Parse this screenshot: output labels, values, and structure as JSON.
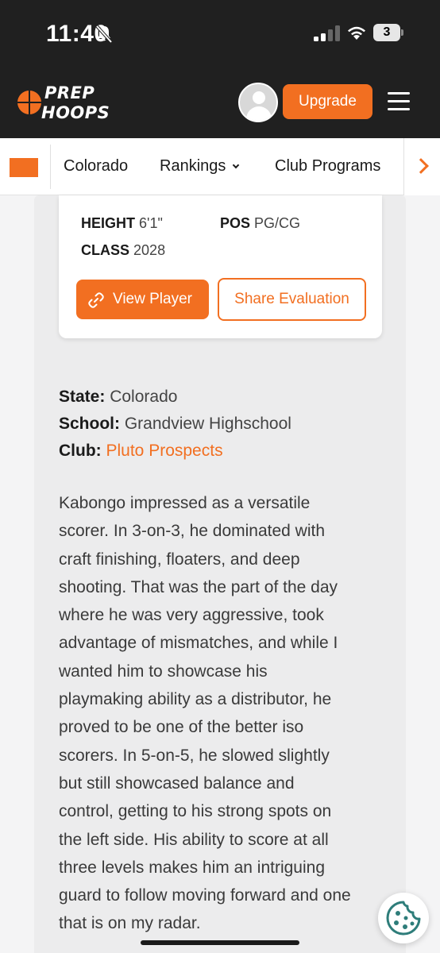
{
  "status_bar": {
    "time": "11:40",
    "battery": "3"
  },
  "header": {
    "logo_line1": "PREP",
    "logo_line2": "HOOPS",
    "upgrade_label": "Upgrade"
  },
  "subnav": {
    "items": [
      {
        "label": "Colorado"
      },
      {
        "label": "Rankings"
      },
      {
        "label": "Club Programs"
      }
    ]
  },
  "player": {
    "height_label": "HEIGHT",
    "height_value": "6'1\"",
    "pos_label": "POS",
    "pos_value": "PG/CG",
    "class_label": "CLASS",
    "class_value": "2028",
    "view_player_label": "View Player",
    "share_label": "Share Evaluation"
  },
  "info": {
    "state_label": "State:",
    "state_value": "Colorado",
    "school_label": "School:",
    "school_value": "Grandview Highschool",
    "club_label": "Club:",
    "club_value": "Pluto Prospects"
  },
  "evaluation": {
    "lines": [
      "Kabongo impressed as a versatile",
      "scorer. In 3-on-3, he dominated with",
      "craft finishing, floaters, and deep",
      "shooting. That was the part of the day",
      "where he was very aggressive, took",
      "advantage of mismatches, and while I",
      "wanted him to showcase his",
      "playmaking ability as a distributor, he",
      "proved to be one of the better iso",
      "scorers. In 5-on-5, he slowed slightly",
      "but still showcased balance and",
      "control, getting to his strong spots on",
      "the left side. His ability to score at all",
      "three levels makes him an intriguing",
      "guard to follow moving forward and one",
      "that is on my radar."
    ]
  },
  "colors": {
    "accent": "#f26f21",
    "dark": "#202020",
    "cookie": "#2e7d7a"
  },
  "icons": [
    "bell-muted-icon",
    "signal-icon",
    "wifi-icon",
    "battery-icon",
    "menu-icon",
    "chevron-down-icon",
    "chevron-right-icon",
    "link-icon",
    "cookie-icon",
    "avatar-icon"
  ]
}
